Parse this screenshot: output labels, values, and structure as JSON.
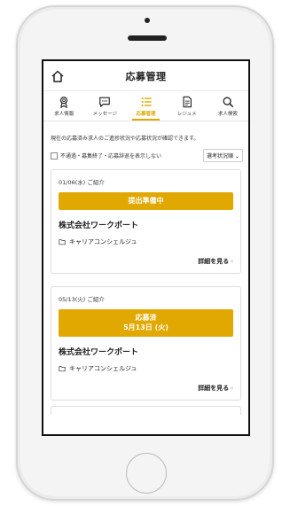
{
  "header": {
    "title": "応募管理"
  },
  "tabs": [
    {
      "label": "求人情報",
      "icon": "ribbon-icon"
    },
    {
      "label": "メッセージ",
      "icon": "chat-icon"
    },
    {
      "label": "応募管理",
      "icon": "list-icon",
      "active": true
    },
    {
      "label": "レジュメ",
      "icon": "document-icon"
    },
    {
      "label": "求人検索",
      "icon": "search-icon"
    }
  ],
  "notice": "現在の応募済み求人のご進捗状況や応募状況が確認できます。",
  "filter": {
    "checkbox_label": "不通過・募集終了・応募辞退を表示しない",
    "sort_value": "選考状況順"
  },
  "applications": [
    {
      "date": "01/06(水) ご紹介",
      "status_line1": "提出準備中",
      "status_line2": "",
      "company": "株式会社ワークポート",
      "job": "キャリアコンシェルジュ",
      "details_label": "詳細を見る"
    },
    {
      "date": "05/13(火) ご紹介",
      "status_line1": "応募済",
      "status_line2": "5月13日 (火)",
      "company": "株式会社ワークポート",
      "job": "キャリアコンシェルジュ",
      "details_label": "詳細を見る"
    }
  ],
  "colors": {
    "accent": "#e0a800"
  }
}
